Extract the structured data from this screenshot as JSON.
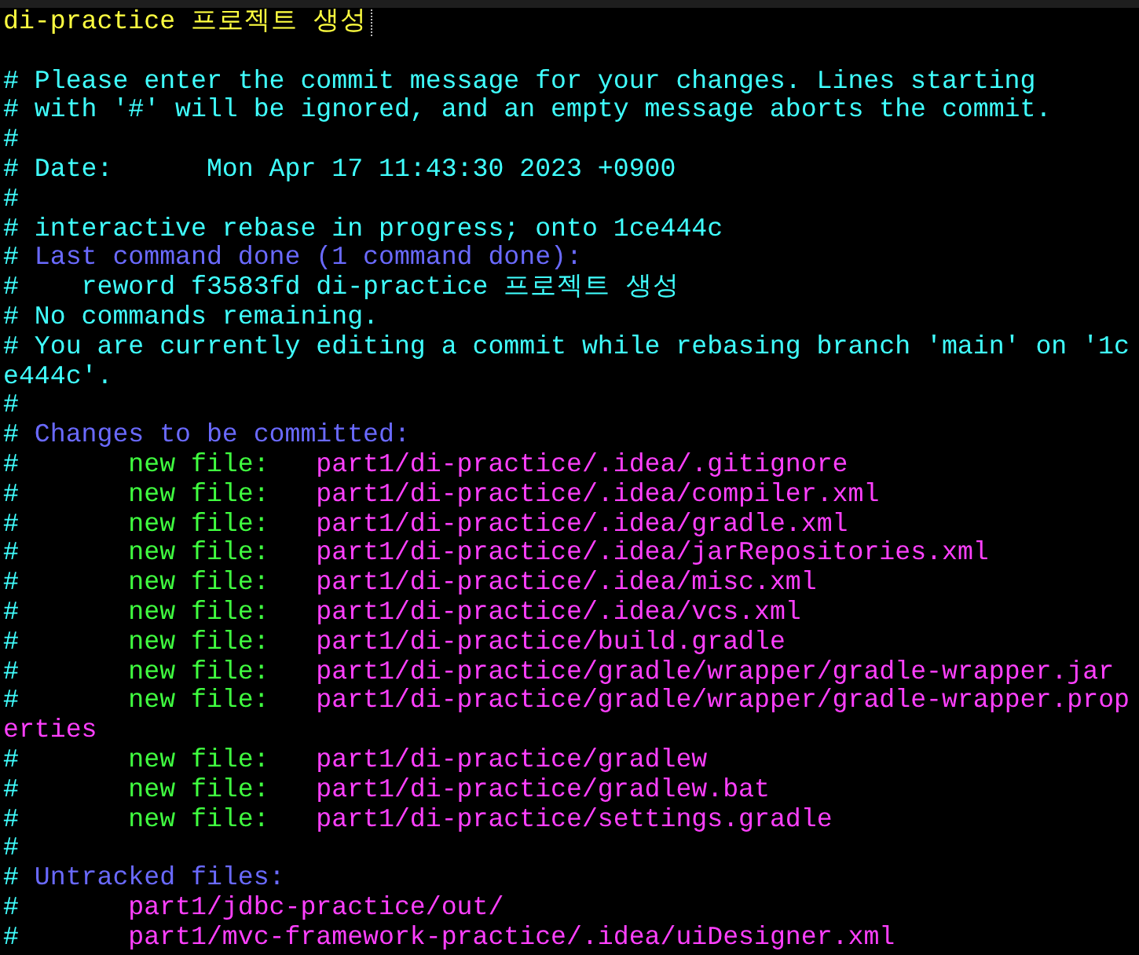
{
  "lines": [
    {
      "kind": "text",
      "segments": [
        {
          "kind": "title",
          "text": "di-practice 프로젝트 생성"
        }
      ],
      "cursor": true
    },
    {
      "kind": "blank"
    },
    {
      "kind": "text",
      "segments": [
        {
          "kind": "comment",
          "text": "# Please enter the commit message for your changes. Lines starting"
        }
      ]
    },
    {
      "kind": "text",
      "segments": [
        {
          "kind": "comment",
          "text": "# with '#' will be ignored, and an empty message aborts the commit."
        }
      ]
    },
    {
      "kind": "text",
      "segments": [
        {
          "kind": "comment",
          "text": "#"
        }
      ]
    },
    {
      "kind": "text",
      "segments": [
        {
          "kind": "comment",
          "text": "# Date:      Mon Apr 17 11:43:30 2023 +0900"
        }
      ]
    },
    {
      "kind": "text",
      "segments": [
        {
          "kind": "comment",
          "text": "#"
        }
      ]
    },
    {
      "kind": "text",
      "segments": [
        {
          "kind": "comment",
          "text": "# interactive rebase in progress; onto 1ce444c"
        }
      ]
    },
    {
      "kind": "text",
      "segments": [
        {
          "kind": "comment",
          "text": "#"
        },
        {
          "kind": "heading",
          "text": " Last command done (1 command done):"
        }
      ]
    },
    {
      "kind": "text",
      "segments": [
        {
          "kind": "comment",
          "text": "#    reword f3583fd di-practice 프로젝트 생성"
        }
      ]
    },
    {
      "kind": "text",
      "segments": [
        {
          "kind": "comment",
          "text": "# No commands remaining."
        }
      ]
    },
    {
      "kind": "text",
      "segments": [
        {
          "kind": "comment",
          "text": "# You are currently editing a commit while rebasing branch 'main' on '1c"
        }
      ]
    },
    {
      "kind": "text",
      "segments": [
        {
          "kind": "comment",
          "text": "e444c'."
        }
      ]
    },
    {
      "kind": "text",
      "segments": [
        {
          "kind": "comment",
          "text": "#"
        }
      ]
    },
    {
      "kind": "text",
      "segments": [
        {
          "kind": "comment",
          "text": "#"
        },
        {
          "kind": "heading",
          "text": " Changes to be committed:"
        }
      ]
    },
    {
      "kind": "text",
      "segments": [
        {
          "kind": "comment",
          "text": "#"
        },
        {
          "kind": "status",
          "text": "       new file:   "
        },
        {
          "kind": "path",
          "text": "part1/di-practice/.idea/.gitignore"
        }
      ]
    },
    {
      "kind": "text",
      "segments": [
        {
          "kind": "comment",
          "text": "#"
        },
        {
          "kind": "status",
          "text": "       new file:   "
        },
        {
          "kind": "path",
          "text": "part1/di-practice/.idea/compiler.xml"
        }
      ]
    },
    {
      "kind": "text",
      "segments": [
        {
          "kind": "comment",
          "text": "#"
        },
        {
          "kind": "status",
          "text": "       new file:   "
        },
        {
          "kind": "path",
          "text": "part1/di-practice/.idea/gradle.xml"
        }
      ]
    },
    {
      "kind": "text",
      "segments": [
        {
          "kind": "comment",
          "text": "#"
        },
        {
          "kind": "status",
          "text": "       new file:   "
        },
        {
          "kind": "path",
          "text": "part1/di-practice/.idea/jarRepositories.xml"
        }
      ]
    },
    {
      "kind": "text",
      "segments": [
        {
          "kind": "comment",
          "text": "#"
        },
        {
          "kind": "status",
          "text": "       new file:   "
        },
        {
          "kind": "path",
          "text": "part1/di-practice/.idea/misc.xml"
        }
      ]
    },
    {
      "kind": "text",
      "segments": [
        {
          "kind": "comment",
          "text": "#"
        },
        {
          "kind": "status",
          "text": "       new file:   "
        },
        {
          "kind": "path",
          "text": "part1/di-practice/.idea/vcs.xml"
        }
      ]
    },
    {
      "kind": "text",
      "segments": [
        {
          "kind": "comment",
          "text": "#"
        },
        {
          "kind": "status",
          "text": "       new file:   "
        },
        {
          "kind": "path",
          "text": "part1/di-practice/build.gradle"
        }
      ]
    },
    {
      "kind": "text",
      "segments": [
        {
          "kind": "comment",
          "text": "#"
        },
        {
          "kind": "status",
          "text": "       new file:   "
        },
        {
          "kind": "path",
          "text": "part1/di-practice/gradle/wrapper/gradle-wrapper.jar"
        }
      ]
    },
    {
      "kind": "text",
      "segments": [
        {
          "kind": "comment",
          "text": "#"
        },
        {
          "kind": "status",
          "text": "       new file:   "
        },
        {
          "kind": "path",
          "text": "part1/di-practice/gradle/wrapper/gradle-wrapper.prop"
        }
      ]
    },
    {
      "kind": "text",
      "segments": [
        {
          "kind": "path",
          "text": "erties"
        }
      ]
    },
    {
      "kind": "text",
      "segments": [
        {
          "kind": "comment",
          "text": "#"
        },
        {
          "kind": "status",
          "text": "       new file:   "
        },
        {
          "kind": "path",
          "text": "part1/di-practice/gradlew"
        }
      ]
    },
    {
      "kind": "text",
      "segments": [
        {
          "kind": "comment",
          "text": "#"
        },
        {
          "kind": "status",
          "text": "       new file:   "
        },
        {
          "kind": "path",
          "text": "part1/di-practice/gradlew.bat"
        }
      ]
    },
    {
      "kind": "text",
      "segments": [
        {
          "kind": "comment",
          "text": "#"
        },
        {
          "kind": "status",
          "text": "       new file:   "
        },
        {
          "kind": "path",
          "text": "part1/di-practice/settings.gradle"
        }
      ]
    },
    {
      "kind": "text",
      "segments": [
        {
          "kind": "comment",
          "text": "#"
        }
      ]
    },
    {
      "kind": "text",
      "segments": [
        {
          "kind": "comment",
          "text": "#"
        },
        {
          "kind": "heading",
          "text": " Untracked files:"
        }
      ]
    },
    {
      "kind": "text",
      "segments": [
        {
          "kind": "comment",
          "text": "#"
        },
        {
          "kind": "path",
          "text": "       part1/jdbc-practice/out/"
        }
      ]
    },
    {
      "kind": "text",
      "segments": [
        {
          "kind": "comment",
          "text": "#"
        },
        {
          "kind": "path",
          "text": "       part1/mvc-framework-practice/.idea/uiDesigner.xml"
        }
      ]
    }
  ]
}
